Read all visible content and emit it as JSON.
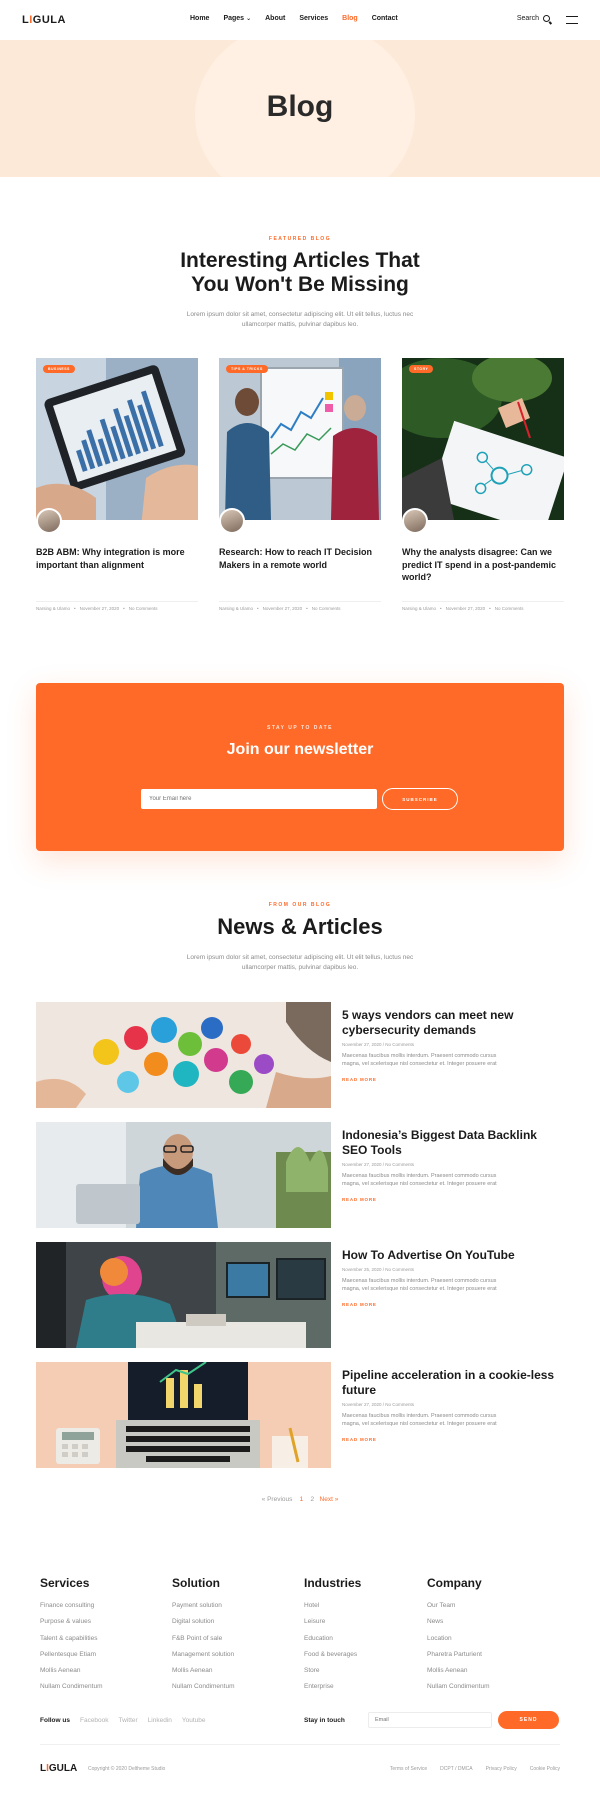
{
  "header": {
    "logo_prefix": "L",
    "logo_accent": "I",
    "logo_suffix": "GULA",
    "nav": [
      {
        "label": "Home"
      },
      {
        "label": "Pages"
      },
      {
        "label": "About"
      },
      {
        "label": "Services"
      },
      {
        "label": "Blog"
      },
      {
        "label": "Contact"
      }
    ],
    "search_label": "Search"
  },
  "hero": {
    "title": "Blog"
  },
  "featured": {
    "kicker": "FEATURED BLOG",
    "title_line1": "Interesting Articles That",
    "title_line2": "You Won't Be Missing",
    "desc_line1": "Lorem ipsum dolor sit amet, consectetur adipiscing elit. Ut elit tellus, luctus nec",
    "desc_line2": "ullamcorper mattis, pulvinar dapibus leo.",
    "cards": [
      {
        "badge": "BUSINESS",
        "title": "B2B ABM: Why integration is more important than alignment",
        "author": "Narsing & Ulamo",
        "date": "November 27, 2020",
        "comments": "No Comments"
      },
      {
        "badge": "TIPS & TRICKS",
        "title": "Research: How to reach IT Decision Makers in a remote world",
        "author": "Narsing & Ulamo",
        "date": "November 27, 2020",
        "comments": "No Comments"
      },
      {
        "badge": "STORY",
        "title": "Why the analysts disagree: Can we predict IT spend in a post-pandemic world?",
        "author": "Narsing & Ulamo",
        "date": "November 27, 2020",
        "comments": "No Comments"
      }
    ]
  },
  "newsletter": {
    "kicker": "STAY UP TO DATE",
    "title": "Join our newsletter",
    "placeholder": "Your Email here",
    "button": "SUBSCRIBE"
  },
  "news": {
    "kicker": "FROM OUR BLOG",
    "title": "News & Articles",
    "desc_line1": "Lorem ipsum dolor sit amet, consectetur adipiscing elit. Ut elit tellus, luctus nec",
    "desc_line2": "ullamcorper mattis, pulvinar dapibus leo.",
    "read_more": "READ MORE",
    "excerpt_line1": "Maecenas faucibus mollis interdum. Praesent commodo cursus",
    "excerpt_line2": "magna, vel scelerisque nisl consectetur et. Integer posuere erat",
    "items": [
      {
        "title": "5 ways vendors can meet new cybersecurity demands",
        "meta": "November 27, 2020 / No Comments"
      },
      {
        "title": "Indonesia’s Biggest Data Backlink SEO Tools",
        "meta": "November 27, 2020 / No Comments"
      },
      {
        "title": "How To Advertise On YouTube",
        "meta": "November 25, 2020 / No Comments"
      },
      {
        "title": "Pipeline acceleration in a cookie-less future",
        "meta": "November 27, 2020 / No Comments"
      }
    ]
  },
  "pagination": {
    "prev": "« Previous",
    "page1": "1",
    "page2": "2",
    "next": "Next »"
  },
  "footer": {
    "columns": [
      {
        "title": "Services",
        "items": [
          "Finance consulting",
          "Purpose & values",
          "Talent & capabilities",
          "Pellentesque Etiam",
          "Mollis Aenean",
          "Nullam Condimentum"
        ]
      },
      {
        "title": "Solution",
        "items": [
          "Payment solution",
          "Digital solution",
          "F&B Point of sale",
          "Management solution",
          "Mollis Aenean",
          "Nullam Condimentum"
        ]
      },
      {
        "title": "Industries",
        "items": [
          "Hotel",
          "Leisure",
          "Education",
          "Food & beverages",
          "Store",
          "Enterprise"
        ]
      },
      {
        "title": "Company",
        "items": [
          "Our Team",
          "News",
          "Location",
          "Pharetra Parturient",
          "Mollis Aenean",
          "Nullam Condimentum"
        ]
      }
    ],
    "follow_label": "Follow us",
    "social": [
      "Facebook",
      "Twitter",
      "Linkedin",
      "Youtube"
    ],
    "stay_label": "Stay in touch",
    "email_placeholder": "Email",
    "send": "SEND",
    "copyright": "Copyright © 2020 Deltheme Studio",
    "legal": [
      "Terms of Service",
      "DCPT / DMCA",
      "Privacy Policy",
      "Cookie Policy"
    ]
  },
  "colors": {
    "accent": "#ff6a28",
    "hero_bg": "#fde9d8",
    "text": "#1b1b1b"
  },
  "icons": [
    "search-icon",
    "hamburger-menu-icon",
    "chevron-down-icon"
  ]
}
